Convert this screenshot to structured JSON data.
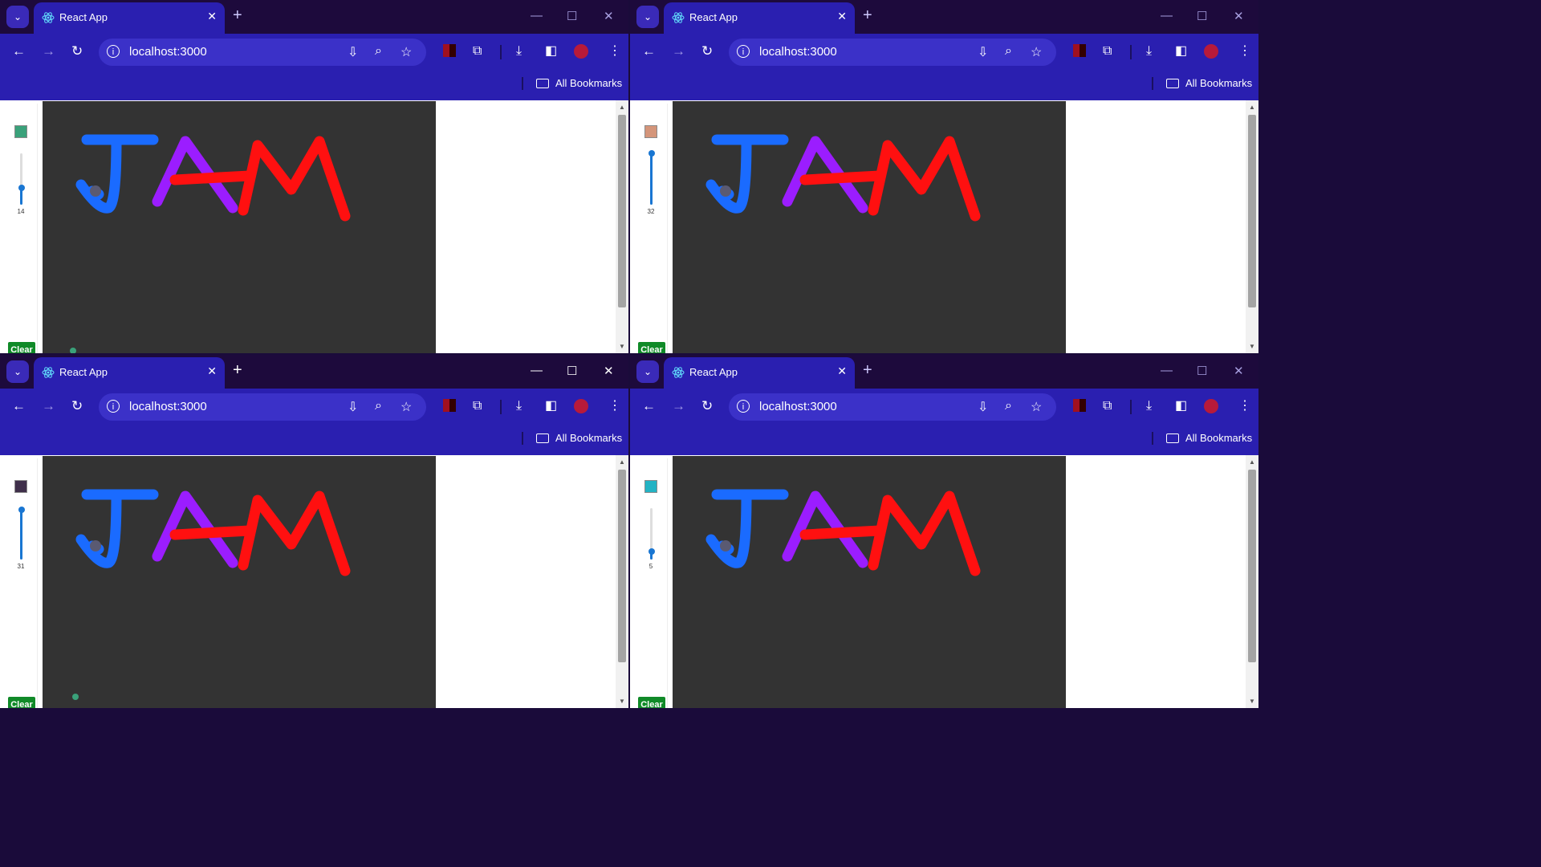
{
  "common": {
    "tab_title": "React App",
    "url": "localhost:3000",
    "bookmarks_label": "All Bookmarks",
    "clear_label": "Clear",
    "drawing": {
      "strokes": [
        {
          "color": "#1a6bff",
          "label": "J"
        },
        {
          "color": "#9b1dff",
          "label": "A"
        },
        {
          "color": "#ff1010",
          "label": "M"
        }
      ]
    }
  },
  "windows": [
    {
      "brush_color": "#3aa17a",
      "brush_size": "14",
      "brush_fraction": 0.33,
      "focused": false
    },
    {
      "brush_color": "#d4957a",
      "brush_size": "32",
      "brush_fraction": 1.0,
      "focused": false
    },
    {
      "brush_color": "#3f2f4a",
      "brush_size": "31",
      "brush_fraction": 0.97,
      "focused": true
    },
    {
      "brush_color": "#23b3c4",
      "brush_size": "5",
      "brush_fraction": 0.15,
      "focused": false
    }
  ]
}
